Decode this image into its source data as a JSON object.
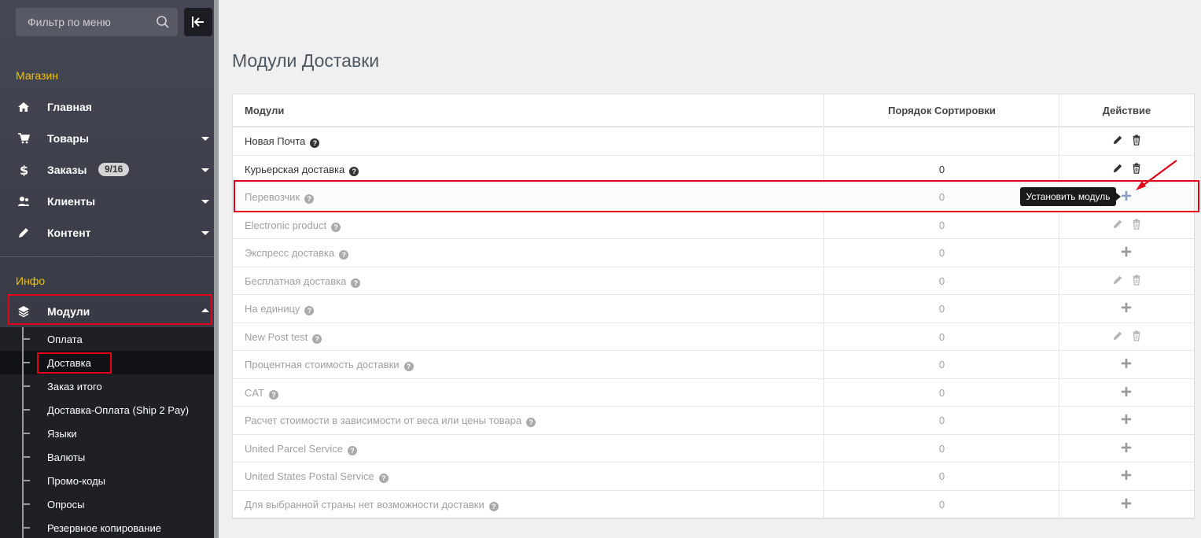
{
  "sidebar": {
    "search_placeholder": "Фильтр по меню",
    "section_shop": "Магазин",
    "items": [
      {
        "label": "Главная"
      },
      {
        "label": "Товары"
      },
      {
        "label": "Заказы",
        "badge": "9/16"
      },
      {
        "label": "Клиенты"
      },
      {
        "label": "Контент"
      }
    ],
    "section_info": "Инфо",
    "modules_label": "Модули",
    "submenu": [
      {
        "label": "Оплата"
      },
      {
        "label": "Доставка"
      },
      {
        "label": "Заказ итого"
      },
      {
        "label": "Доставка-Оплата (Ship 2 Pay)"
      },
      {
        "label": "Языки"
      },
      {
        "label": "Валюты"
      },
      {
        "label": "Промо-коды"
      },
      {
        "label": "Опросы"
      },
      {
        "label": "Резервное копирование"
      }
    ]
  },
  "main": {
    "title": "Модули Доставки",
    "columns": {
      "modules": "Модули",
      "sort": "Порядок Сортировки",
      "action": "Действие"
    },
    "rows": [
      {
        "name": "Новая Почта",
        "sort": ""
      },
      {
        "name": "Курьерская доставка",
        "sort": "0"
      },
      {
        "name": "Перевозчик",
        "sort": "0"
      },
      {
        "name": "Electronic product",
        "sort": "0"
      },
      {
        "name": "Экспресс доставка",
        "sort": "0"
      },
      {
        "name": "Бесплатная доставка",
        "sort": "0"
      },
      {
        "name": "На единицу",
        "sort": "0"
      },
      {
        "name": "New Post test",
        "sort": "0"
      },
      {
        "name": "Процентная стоимость доставки",
        "sort": "0"
      },
      {
        "name": "CAT",
        "sort": "0"
      },
      {
        "name": "Расчет стоимости в зависимости от веса или цены товара",
        "sort": "0"
      },
      {
        "name": "United Parcel Service",
        "sort": "0"
      },
      {
        "name": "United States Postal Service",
        "sort": "0"
      },
      {
        "name": "Для выбранной страны нет возможности доставки",
        "sort": "0"
      }
    ],
    "tooltip": "Установить модуль"
  },
  "colors": {
    "accent_yellow": "#f2c100",
    "highlight_red": "#e3001b",
    "sidebar_bg": "#3b3e48"
  }
}
